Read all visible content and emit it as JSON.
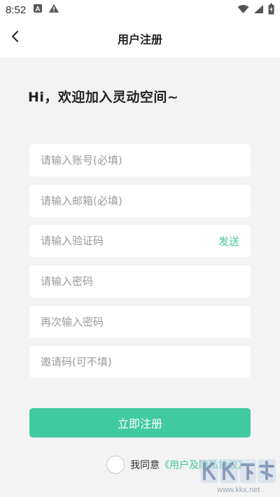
{
  "status_bar": {
    "time": "8:52",
    "icons_left": [
      "a-box-icon",
      "warning-icon"
    ],
    "icons_right": [
      "wifi-icon",
      "signal-icon",
      "battery-icon"
    ]
  },
  "nav": {
    "title": "用户注册",
    "back_icon": "chevron-left-icon"
  },
  "welcome": "Hi，欢迎加入灵动空间~",
  "form": {
    "account_placeholder": "请输入账号(必填)",
    "email_placeholder": "请输入邮箱(必填)",
    "code_placeholder": "请输入验证码",
    "send_label": "发送",
    "password_placeholder": "请输入密码",
    "password_confirm_placeholder": "再次输入密码",
    "invite_placeholder": "邀请码(可不填)",
    "submit_label": "立即注册"
  },
  "agreement": {
    "prefix": "我同意",
    "link": "《用户及隐私协议》"
  },
  "watermark": {
    "logo_text": "KK下载",
    "url": "www.kkx.net"
  },
  "colors": {
    "accent": "#41c9a0",
    "background": "#f3f3f3",
    "field_bg": "#ffffff"
  }
}
